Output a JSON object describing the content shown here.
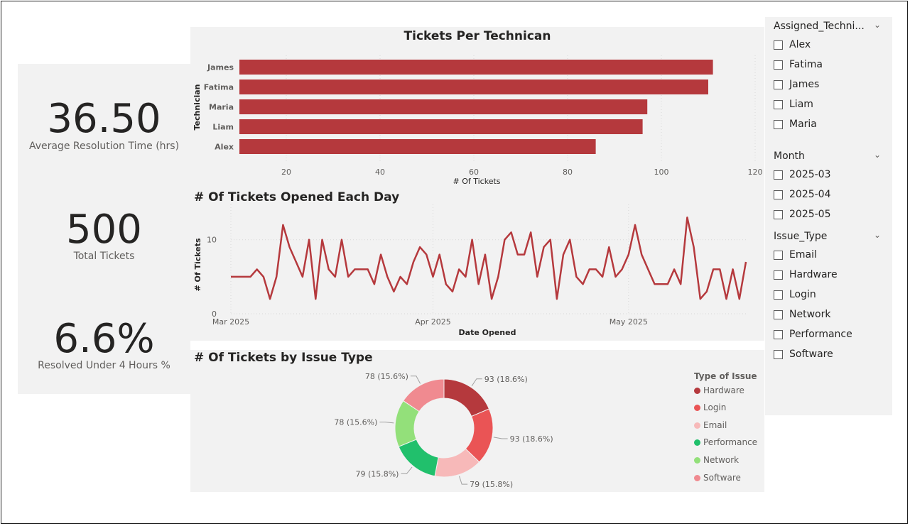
{
  "kpis": {
    "avg_resolution": {
      "value": "36.50",
      "label": "Average Resolution Time (hrs)"
    },
    "total_tickets": {
      "value": "500",
      "label": "Total Tickets"
    },
    "resolved_under_4": {
      "value": "6.6%",
      "label": "Resolved Under 4 Hours %"
    }
  },
  "colors": {
    "bar": "#b5393d",
    "line": "#b5393d",
    "panel": "#f2f2f2",
    "hardware": "#b5393d",
    "login": "#ea5455",
    "email": "#f7b9b9",
    "performance": "#21c06c",
    "network": "#93e07a",
    "software": "#f08a90"
  },
  "slicers": {
    "technician": {
      "title": "Assigned_Techni...",
      "items": [
        "Alex",
        "Fatima",
        "James",
        "Liam",
        "Maria"
      ]
    },
    "month": {
      "title": "Month",
      "items": [
        "2025-03",
        "2025-04",
        "2025-05"
      ]
    },
    "issue_type": {
      "title": "Issue_Type",
      "items": [
        "Email",
        "Hardware",
        "Login",
        "Network",
        "Performance",
        "Software"
      ]
    }
  },
  "chart_data": [
    {
      "type": "bar",
      "orientation": "horizontal",
      "title": "Tickets Per Technican",
      "xlabel": "# Of Tickets",
      "ylabel": "Technician",
      "categories": [
        "James",
        "Fatima",
        "Maria",
        "Liam",
        "Alex"
      ],
      "values": [
        111,
        110,
        97,
        96,
        86
      ],
      "xlim": [
        10,
        120
      ],
      "xticks": [
        "20",
        "40",
        "60",
        "80",
        "100",
        "120"
      ],
      "grid": true
    },
    {
      "type": "line",
      "title": "# Of Tickets Opened Each Day",
      "xlabel": "Date Opened",
      "ylabel": "# Of Tickets",
      "xticks": [
        "Mar 2025",
        "Apr 2025",
        "May 2025"
      ],
      "yticks": [
        "0",
        "10"
      ],
      "ylim": [
        0,
        14
      ],
      "x_start": "2025-03-01",
      "values": [
        5,
        5,
        5,
        5,
        6,
        5,
        2,
        5,
        12,
        9,
        7,
        5,
        10,
        2,
        10,
        6,
        5,
        10,
        5,
        6,
        6,
        6,
        4,
        8,
        5,
        3,
        5,
        4,
        7,
        9,
        8,
        5,
        8,
        4,
        3,
        6,
        5,
        10,
        4,
        8,
        2,
        5,
        10,
        11,
        8,
        8,
        11,
        5,
        9,
        10,
        2,
        8,
        10,
        5,
        4,
        6,
        6,
        5,
        9,
        5,
        6,
        8,
        12,
        8,
        6,
        4,
        4,
        4,
        6,
        4,
        13,
        9,
        2,
        3,
        6,
        6,
        2,
        6,
        2,
        7
      ],
      "grid": true
    },
    {
      "type": "pie",
      "donut": true,
      "title": "# Of Tickets by Issue Type",
      "legend_title": "Type of Issue",
      "legend_position": "right",
      "categories": [
        "Hardware",
        "Login",
        "Email",
        "Performance",
        "Network",
        "Software"
      ],
      "values": [
        93,
        93,
        79,
        79,
        78,
        78
      ],
      "labels": [
        "93 (18.6%)",
        "93 (18.6%)",
        "79 (15.8%)",
        "79 (15.8%)",
        "78 (15.6%)",
        "78 (15.6%)"
      ]
    }
  ]
}
